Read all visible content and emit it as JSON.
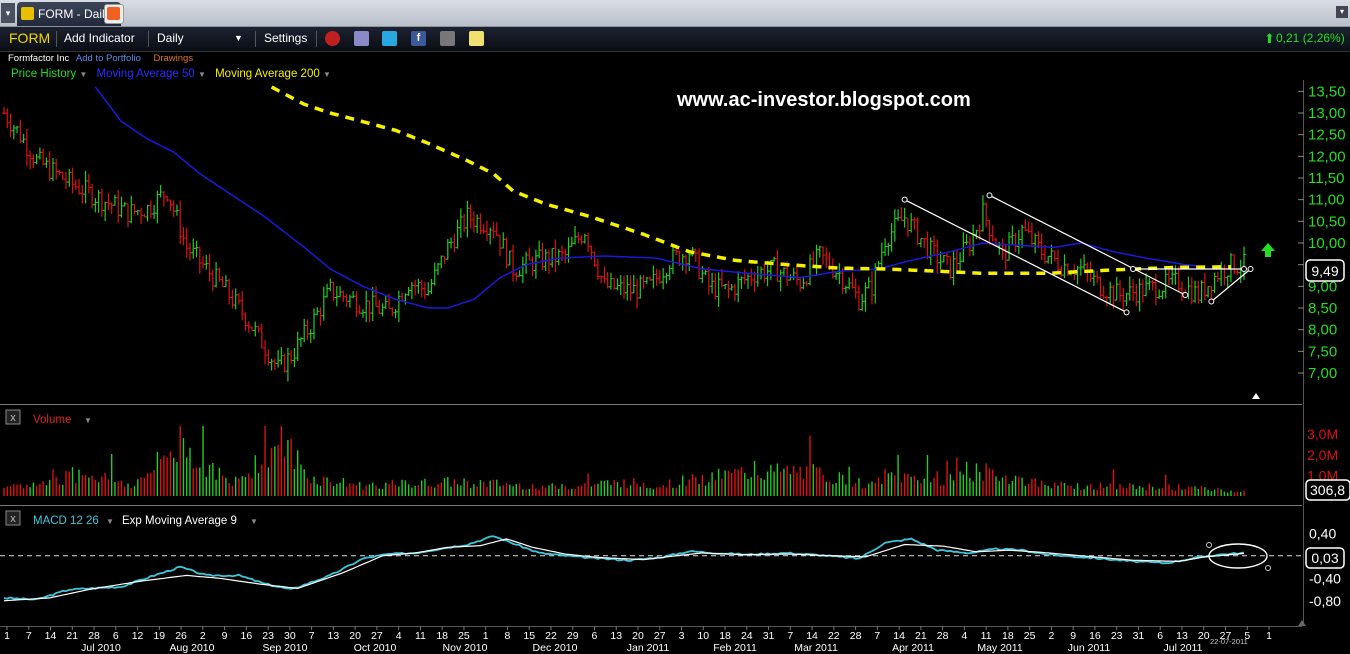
{
  "tab": {
    "title": "FORM - Daily",
    "menu_glyph": "▾"
  },
  "toolbar": {
    "symbol": "FORM",
    "add_indicator": "Add Indicator",
    "period": "Daily",
    "period_arrow": "▼",
    "settings": "Settings",
    "icons": [
      "alarm-clock-icon",
      "database-icon",
      "twitter-icon",
      "facebook-icon",
      "binoculars-icon",
      "note-icon"
    ],
    "change": "0,21 (2,26%)",
    "change_color": "#22dd22"
  },
  "company": {
    "name": "Formfactor Inc",
    "add_portfolio": "Add to Portfolio",
    "drawings": "Drawings"
  },
  "legend": {
    "price_history": "Price History",
    "ma50": "Moving Average 50",
    "ma200": "Moving Average 200",
    "dropdown": "▼"
  },
  "watermark": "www.ac-investor.blogspot.com",
  "colors": {
    "up": "#22cc22",
    "down": "#dd1111",
    "ma50": "#1a1adc",
    "ma200": "#f5f000",
    "macd": "#3cc8dc",
    "signal": "#ffffff",
    "axis_label": "#22dd22"
  },
  "volume_panel": {
    "label": "Volume",
    "last": "306,8",
    "ticks": [
      "3,0M",
      "2,0M",
      "1,0M"
    ]
  },
  "macd_panel": {
    "label": "MACD 12 26",
    "signal_label": "Exp Moving Average 9",
    "last": "0,03",
    "ticks": [
      "0,40",
      "-0,40",
      "-0,80"
    ]
  },
  "price_axis_ticks": [
    "13,50",
    "13,00",
    "12,50",
    "12,00",
    "11,50",
    "11,00",
    "10,50",
    "10,00",
    "9,50",
    "9,00",
    "8,50",
    "8,00",
    "7,50",
    "7,00"
  ],
  "last_price": "9,49",
  "date_stamp": "22-07-2011",
  "x_day_labels": [
    "1",
    "7",
    "14",
    "21",
    "28",
    "6",
    "12",
    "19",
    "26",
    "2",
    "9",
    "16",
    "23",
    "30",
    "7",
    "13",
    "20",
    "27",
    "4",
    "11",
    "18",
    "25",
    "1",
    "8",
    "15",
    "22",
    "29",
    "6",
    "13",
    "20",
    "27",
    "3",
    "10",
    "18",
    "24",
    "31",
    "7",
    "14",
    "22",
    "28",
    "7",
    "14",
    "21",
    "28",
    "4",
    "11",
    "18",
    "25",
    "2",
    "9",
    "16",
    "23",
    "31",
    "6",
    "13",
    "20",
    "27",
    "5",
    "1"
  ],
  "x_month_labels": [
    "Jul 2010",
    "Aug 2010",
    "Sep 2010",
    "Oct 2010",
    "Nov 2010",
    "Dec 2010",
    "Jan 2011",
    "Feb 2011",
    "Mar 2011",
    "Apr 2011",
    "May 2011",
    "Jun 2011",
    "Jul 2011"
  ],
  "chart_data": {
    "type": "bar",
    "ylim": [
      6.7,
      13.6
    ],
    "ma200_start_index": 82,
    "ohlc_anchors": [
      [
        0,
        13.0
      ],
      [
        4,
        12.6
      ],
      [
        10,
        11.9
      ],
      [
        20,
        11.4
      ],
      [
        30,
        11.0
      ],
      [
        38,
        10.7
      ],
      [
        44,
        10.8
      ],
      [
        50,
        11.2
      ],
      [
        56,
        9.9
      ],
      [
        62,
        9.4
      ],
      [
        68,
        8.9
      ],
      [
        74,
        8.3
      ],
      [
        80,
        7.6
      ],
      [
        84,
        7.1
      ],
      [
        88,
        7.4
      ],
      [
        94,
        8.1
      ],
      [
        100,
        8.9
      ],
      [
        110,
        8.6
      ],
      [
        118,
        8.4
      ],
      [
        124,
        9.1
      ],
      [
        130,
        8.9
      ],
      [
        136,
        9.9
      ],
      [
        142,
        10.6
      ],
      [
        150,
        10.4
      ],
      [
        156,
        9.4
      ],
      [
        164,
        9.6
      ],
      [
        172,
        9.7
      ],
      [
        178,
        10.3
      ],
      [
        184,
        9.0
      ],
      [
        192,
        8.9
      ],
      [
        198,
        9.0
      ],
      [
        204,
        9.6
      ],
      [
        210,
        9.8
      ],
      [
        216,
        9.0
      ],
      [
        222,
        8.9
      ],
      [
        230,
        9.3
      ],
      [
        236,
        9.4
      ],
      [
        244,
        9.1
      ],
      [
        250,
        9.7
      ],
      [
        256,
        9.3
      ],
      [
        262,
        8.7
      ],
      [
        266,
        9.0
      ],
      [
        270,
        10.1
      ],
      [
        276,
        10.6
      ],
      [
        284,
        9.8
      ],
      [
        290,
        9.4
      ],
      [
        296,
        10.0
      ],
      [
        300,
        10.7
      ],
      [
        306,
        9.7
      ],
      [
        312,
        10.3
      ],
      [
        318,
        9.8
      ],
      [
        324,
        9.5
      ],
      [
        330,
        9.4
      ],
      [
        336,
        9.0
      ],
      [
        342,
        8.8
      ],
      [
        348,
        8.9
      ],
      [
        354,
        9.0
      ],
      [
        360,
        9.1
      ],
      [
        366,
        8.8
      ],
      [
        372,
        9.3
      ],
      [
        376,
        9.49
      ]
    ],
    "ma50_anchors": [
      [
        28,
        13.6
      ],
      [
        36,
        12.8
      ],
      [
        44,
        12.4
      ],
      [
        52,
        12.1
      ],
      [
        60,
        11.6
      ],
      [
        70,
        11.1
      ],
      [
        80,
        10.6
      ],
      [
        92,
        9.9
      ],
      [
        100,
        9.4
      ],
      [
        110,
        9.0
      ],
      [
        120,
        8.7
      ],
      [
        130,
        8.5
      ],
      [
        136,
        8.5
      ],
      [
        144,
        8.7
      ],
      [
        152,
        9.2
      ],
      [
        160,
        9.5
      ],
      [
        170,
        9.65
      ],
      [
        184,
        9.7
      ],
      [
        200,
        9.65
      ],
      [
        214,
        9.4
      ],
      [
        228,
        9.3
      ],
      [
        244,
        9.2
      ],
      [
        256,
        9.35
      ],
      [
        268,
        9.4
      ],
      [
        278,
        9.6
      ],
      [
        290,
        9.8
      ],
      [
        300,
        10.0
      ],
      [
        310,
        9.95
      ],
      [
        322,
        9.9
      ],
      [
        330,
        10.0
      ],
      [
        340,
        9.8
      ],
      [
        350,
        9.65
      ],
      [
        362,
        9.5
      ],
      [
        368,
        9.45
      ]
    ],
    "ma200_anchors": [
      [
        82,
        13.6
      ],
      [
        92,
        13.2
      ],
      [
        100,
        13.0
      ],
      [
        110,
        12.8
      ],
      [
        120,
        12.6
      ],
      [
        130,
        12.3
      ],
      [
        142,
        11.9
      ],
      [
        150,
        11.6
      ],
      [
        156,
        11.2
      ],
      [
        166,
        10.9
      ],
      [
        180,
        10.6
      ],
      [
        196,
        10.2
      ],
      [
        210,
        9.8
      ],
      [
        224,
        9.6
      ],
      [
        240,
        9.5
      ],
      [
        256,
        9.42
      ],
      [
        270,
        9.4
      ],
      [
        286,
        9.35
      ],
      [
        300,
        9.3
      ],
      [
        320,
        9.3
      ],
      [
        340,
        9.38
      ],
      [
        360,
        9.44
      ],
      [
        376,
        9.45
      ]
    ],
    "trend_lines": [
      [
        [
          276,
          11.0
        ],
        [
          344,
          8.4
        ]
      ],
      [
        [
          302,
          11.1
        ],
        [
          362,
          8.8
        ]
      ],
      [
        [
          346,
          9.4
        ],
        [
          380,
          9.4
        ]
      ],
      [
        [
          370,
          8.65
        ],
        [
          382,
          9.4
        ]
      ]
    ],
    "volume_ylim": [
      0,
      3.4
    ],
    "volume_anchors": [
      [
        0,
        0.4
      ],
      [
        14,
        0.8
      ],
      [
        24,
        1.4
      ],
      [
        40,
        0.6
      ],
      [
        54,
        3.0
      ],
      [
        70,
        0.6
      ],
      [
        82,
        2.8
      ],
      [
        86,
        3.0
      ],
      [
        94,
        1.0
      ],
      [
        110,
        0.6
      ],
      [
        140,
        0.8
      ],
      [
        170,
        0.5
      ],
      [
        190,
        0.8
      ],
      [
        200,
        0.6
      ],
      [
        226,
        1.3
      ],
      [
        246,
        1.4
      ],
      [
        266,
        0.6
      ],
      [
        270,
        1.1
      ],
      [
        290,
        1.0
      ],
      [
        300,
        1.4
      ],
      [
        320,
        0.6
      ],
      [
        360,
        0.5
      ],
      [
        376,
        0.3
      ]
    ],
    "macd_ylim": [
      -1.0,
      0.6
    ],
    "macd_anchors": [
      [
        0,
        -0.75
      ],
      [
        10,
        -0.78
      ],
      [
        20,
        -0.6
      ],
      [
        36,
        -0.55
      ],
      [
        46,
        -0.35
      ],
      [
        54,
        -0.2
      ],
      [
        62,
        -0.35
      ],
      [
        72,
        -0.35
      ],
      [
        80,
        -0.5
      ],
      [
        88,
        -0.6
      ],
      [
        100,
        -0.35
      ],
      [
        110,
        -0.05
      ],
      [
        118,
        0.03
      ],
      [
        126,
        0.05
      ],
      [
        134,
        0.13
      ],
      [
        142,
        0.2
      ],
      [
        150,
        0.35
      ],
      [
        156,
        0.22
      ],
      [
        164,
        0.05
      ],
      [
        172,
        0.0
      ],
      [
        180,
        -0.04
      ],
      [
        192,
        -0.08
      ],
      [
        202,
        -0.02
      ],
      [
        210,
        0.08
      ],
      [
        218,
        0.05
      ],
      [
        228,
        0.02
      ],
      [
        240,
        0.05
      ],
      [
        252,
        0.0
      ],
      [
        262,
        -0.05
      ],
      [
        270,
        0.23
      ],
      [
        278,
        0.3
      ],
      [
        286,
        0.1
      ],
      [
        296,
        0.05
      ],
      [
        304,
        0.12
      ],
      [
        312,
        0.1
      ],
      [
        320,
        0.02
      ],
      [
        332,
        -0.03
      ],
      [
        346,
        -0.1
      ],
      [
        356,
        -0.13
      ],
      [
        366,
        -0.03
      ],
      [
        372,
        0.02
      ],
      [
        380,
        0.05
      ]
    ],
    "signal_anchors": [
      [
        0,
        -0.8
      ],
      [
        14,
        -0.75
      ],
      [
        26,
        -0.6
      ],
      [
        42,
        -0.45
      ],
      [
        56,
        -0.35
      ],
      [
        66,
        -0.4
      ],
      [
        78,
        -0.5
      ],
      [
        90,
        -0.58
      ],
      [
        104,
        -0.3
      ],
      [
        116,
        0.0
      ],
      [
        126,
        0.05
      ],
      [
        136,
        0.15
      ],
      [
        146,
        0.18
      ],
      [
        154,
        0.3
      ],
      [
        162,
        0.15
      ],
      [
        172,
        0.03
      ],
      [
        182,
        -0.03
      ],
      [
        196,
        -0.07
      ],
      [
        206,
        0.0
      ],
      [
        214,
        0.05
      ],
      [
        226,
        0.02
      ],
      [
        240,
        0.03
      ],
      [
        254,
        0.0
      ],
      [
        264,
        -0.02
      ],
      [
        276,
        0.2
      ],
      [
        288,
        0.17
      ],
      [
        298,
        0.07
      ],
      [
        308,
        0.1
      ],
      [
        318,
        0.06
      ],
      [
        330,
        0.0
      ],
      [
        346,
        -0.08
      ],
      [
        360,
        -0.1
      ],
      [
        368,
        -0.02
      ],
      [
        380,
        0.04
      ]
    ]
  }
}
